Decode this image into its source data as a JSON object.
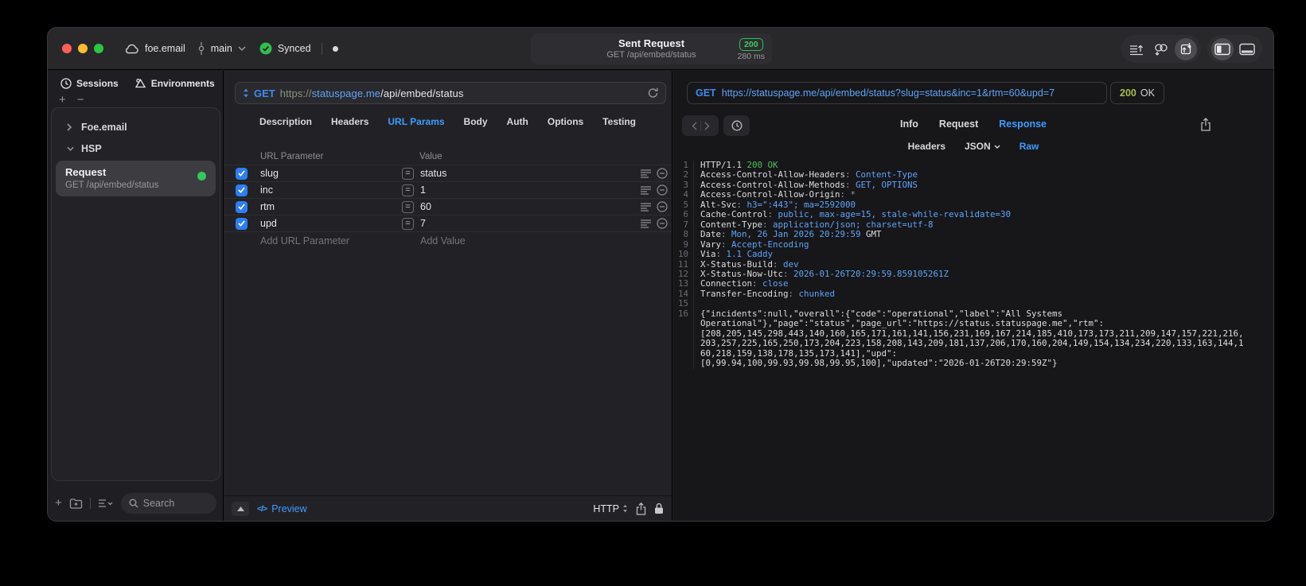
{
  "colors": {
    "accent_blue": "#3f9bff",
    "url_blue": "#5fa4f6",
    "green": "#30d158",
    "status_olive": "#a6bd4e",
    "checkbox_blue": "#2e7ef0"
  },
  "titlebar": {
    "project": "foe.email",
    "branch": "main",
    "sync_label": "Synced",
    "request_title": "Sent Request",
    "request_subtitle": "GET /api/embed/status",
    "status_code": "200",
    "duration": "280 ms"
  },
  "sidebar": {
    "tabs": [
      {
        "label": "Sessions"
      },
      {
        "label": "Environments"
      }
    ],
    "groups": [
      {
        "label": "Foe.email",
        "expanded": false
      },
      {
        "label": "HSP",
        "expanded": true
      }
    ],
    "request": {
      "title": "Request",
      "subtitle": "GET /api/embed/status"
    },
    "search_placeholder": "Search"
  },
  "request_editor": {
    "method": "GET",
    "url": {
      "scheme": "https://",
      "host": "statuspage.me",
      "path": "/api/embed/status"
    },
    "tabs": [
      "Description",
      "Headers",
      "URL Params",
      "Body",
      "Auth",
      "Options",
      "Testing"
    ],
    "active_tab": "URL Params",
    "params": {
      "columns": {
        "name": "URL Parameter",
        "value": "Value"
      },
      "equals_symbol": "=",
      "rows": [
        {
          "enabled": true,
          "name": "slug",
          "value": "status"
        },
        {
          "enabled": true,
          "name": "inc",
          "value": "1"
        },
        {
          "enabled": true,
          "name": "rtm",
          "value": "60"
        },
        {
          "enabled": true,
          "name": "upd",
          "value": "7"
        }
      ],
      "add_name": "Add URL Parameter",
      "add_value": "Add Value"
    },
    "footer": {
      "code_symbol": "</>",
      "preview": "Preview",
      "protocol": "HTTP"
    }
  },
  "response_viewer": {
    "method": "GET",
    "url": "https://statuspage.me/api/embed/status?slug=status&inc=1&rtm=60&upd=7",
    "status_code": "200",
    "status_text": "OK",
    "tabs": [
      "Info",
      "Request",
      "Response"
    ],
    "active_tab": "Response",
    "subtabs": [
      "Headers",
      "JSON",
      "Raw"
    ],
    "active_subtab": "Raw",
    "body_lines": [
      {
        "num": "1",
        "segments": [
          {
            "text": "HTTP/1.1 ",
            "color": "plain"
          },
          {
            "text": "200 OK",
            "color": "green"
          }
        ]
      },
      {
        "num": "2",
        "segments": [
          {
            "text": "Access-Control-Allow-Headers",
            "color": "plain"
          },
          {
            "text": ": ",
            "color": "dim"
          },
          {
            "text": "Content-Type",
            "color": "blue"
          }
        ]
      },
      {
        "num": "3",
        "segments": [
          {
            "text": "Access-Control-Allow-Methods",
            "color": "plain"
          },
          {
            "text": ": ",
            "color": "dim"
          },
          {
            "text": "GET, OPTIONS",
            "color": "blue"
          }
        ]
      },
      {
        "num": "4",
        "segments": [
          {
            "text": "Access-Control-Allow-Origin",
            "color": "plain"
          },
          {
            "text": ": ",
            "color": "dim"
          },
          {
            "text": "*",
            "color": "dim"
          }
        ]
      },
      {
        "num": "5",
        "segments": [
          {
            "text": "Alt-Svc",
            "color": "plain"
          },
          {
            "text": ": ",
            "color": "dim"
          },
          {
            "text": "h3=\":443\"; ma=2592000",
            "color": "blue"
          }
        ]
      },
      {
        "num": "6",
        "segments": [
          {
            "text": "Cache-Control",
            "color": "plain"
          },
          {
            "text": ": ",
            "color": "dim"
          },
          {
            "text": "public, max-age=15, stale-while-revalidate=30",
            "color": "blue"
          }
        ]
      },
      {
        "num": "7",
        "segments": [
          {
            "text": "Content-Type",
            "color": "plain"
          },
          {
            "text": ": ",
            "color": "dim"
          },
          {
            "text": "application/json; charset=utf-8",
            "color": "blue"
          }
        ]
      },
      {
        "num": "8",
        "segments": [
          {
            "text": "Date",
            "color": "plain"
          },
          {
            "text": ": ",
            "color": "dim"
          },
          {
            "text": "Mon, 26 Jan 2026 20:29:59",
            "color": "blue"
          },
          {
            "text": " GMT",
            "color": "plain"
          }
        ]
      },
      {
        "num": "9",
        "segments": [
          {
            "text": "Vary",
            "color": "plain"
          },
          {
            "text": ": ",
            "color": "dim"
          },
          {
            "text": "Accept-Encoding",
            "color": "blue"
          }
        ]
      },
      {
        "num": "10",
        "segments": [
          {
            "text": "Via",
            "color": "plain"
          },
          {
            "text": ": ",
            "color": "dim"
          },
          {
            "text": "1.1 Caddy",
            "color": "blue"
          }
        ]
      },
      {
        "num": "11",
        "segments": [
          {
            "text": "X-Status-Build",
            "color": "plain"
          },
          {
            "text": ": ",
            "color": "dim"
          },
          {
            "text": "dev",
            "color": "blue"
          }
        ]
      },
      {
        "num": "12",
        "segments": [
          {
            "text": "X-Status-Now-Utc",
            "color": "plain"
          },
          {
            "text": ": ",
            "color": "dim"
          },
          {
            "text": "2026-01-26T20:29:59.859105261Z",
            "color": "blue"
          }
        ]
      },
      {
        "num": "13",
        "segments": [
          {
            "text": "Connection",
            "color": "plain"
          },
          {
            "text": ": ",
            "color": "dim"
          },
          {
            "text": "close",
            "color": "blue"
          }
        ]
      },
      {
        "num": "14",
        "segments": [
          {
            "text": "Transfer-Encoding",
            "color": "plain"
          },
          {
            "text": ": ",
            "color": "dim"
          },
          {
            "text": "chunked",
            "color": "blue"
          }
        ]
      },
      {
        "num": "15",
        "segments": []
      },
      {
        "num": "16",
        "segments": [
          {
            "text": "{\"incidents\":null,\"overall\":{\"code\":\"operational\",\"label\":\"All Systems",
            "color": "plain"
          }
        ]
      },
      {
        "num": null,
        "segments": [
          {
            "text": "Operational\"},\"page\":\"status\",\"page_url\":\"https://status.statuspage.me\",\"rtm\":",
            "color": "plain"
          }
        ]
      },
      {
        "num": null,
        "segments": [
          {
            "text": "[208,205,145,298,443,140,160,165,171,161,141,156,231,169,167,214,185,410,173,173,211,209,147,157,221,216,",
            "color": "plain"
          }
        ]
      },
      {
        "num": null,
        "segments": [
          {
            "text": "203,257,225,165,250,173,204,223,158,208,143,209,181,137,206,170,160,204,149,154,134,234,220,133,163,144,1",
            "color": "plain"
          }
        ]
      },
      {
        "num": null,
        "segments": [
          {
            "text": "60,218,159,138,178,135,173,141],\"upd\":",
            "color": "plain"
          }
        ]
      },
      {
        "num": null,
        "segments": [
          {
            "text": "[0,99.94,100,99.93,99.98,99.95,100],\"updated\":\"2026-01-26T20:29:59Z\"}",
            "color": "plain"
          }
        ]
      }
    ]
  }
}
